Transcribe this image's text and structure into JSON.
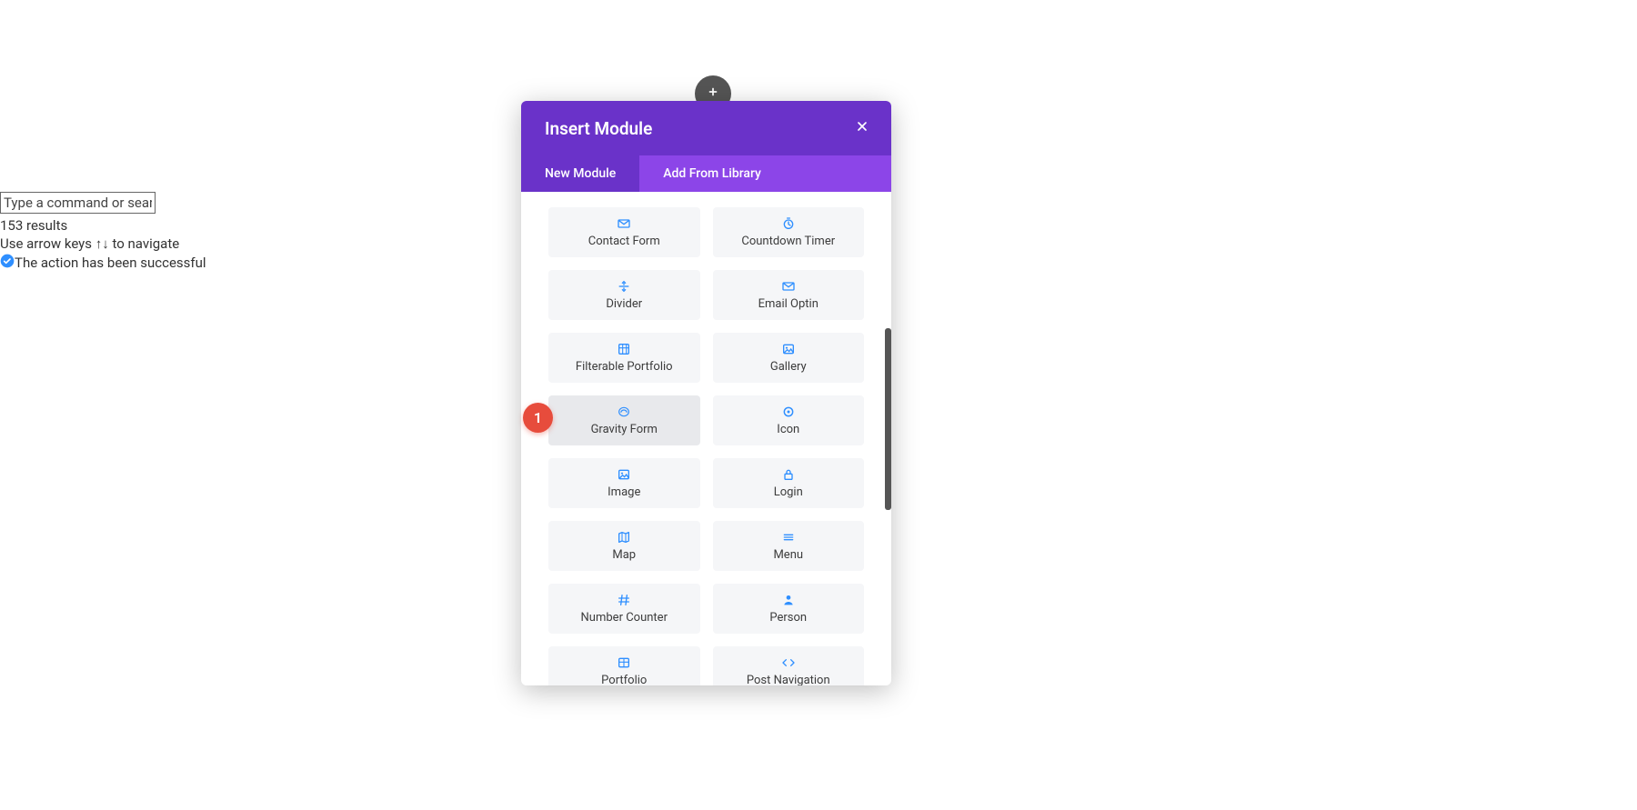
{
  "command_palette": {
    "placeholder": "Type a command or search",
    "results_text": "153 results",
    "nav_hint": "Use arrow keys ↑↓ to navigate",
    "status_text": "The action has been successful"
  },
  "step_badge": "1",
  "modal": {
    "title": "Insert Module",
    "tabs": {
      "new_module": "New Module",
      "add_from_library": "Add From Library"
    },
    "modules": [
      {
        "label": "Contact Form",
        "icon": "mail"
      },
      {
        "label": "Countdown Timer",
        "icon": "timer"
      },
      {
        "label": "Divider",
        "icon": "divider"
      },
      {
        "label": "Email Optin",
        "icon": "mail"
      },
      {
        "label": "Filterable Portfolio",
        "icon": "grid"
      },
      {
        "label": "Gallery",
        "icon": "image"
      },
      {
        "label": "Gravity Form",
        "icon": "gf",
        "hover": true
      },
      {
        "label": "Icon",
        "icon": "circle"
      },
      {
        "label": "Image",
        "icon": "image"
      },
      {
        "label": "Login",
        "icon": "lock"
      },
      {
        "label": "Map",
        "icon": "map"
      },
      {
        "label": "Menu",
        "icon": "menu"
      },
      {
        "label": "Number Counter",
        "icon": "hash"
      },
      {
        "label": "Person",
        "icon": "person"
      },
      {
        "label": "Portfolio",
        "icon": "grid2"
      },
      {
        "label": "Post Navigation",
        "icon": "code"
      }
    ]
  }
}
